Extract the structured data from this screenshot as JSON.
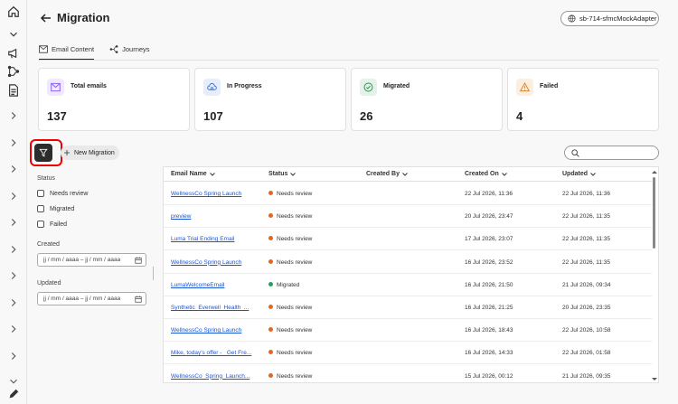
{
  "header": {
    "title": "Migration",
    "sandbox": "sb-714-sfmcMockAdapter"
  },
  "tabs": [
    {
      "label": "Email Content",
      "icon": "mail-icon",
      "active": true
    },
    {
      "label": "Journeys",
      "icon": "journey-icon",
      "active": false
    }
  ],
  "cards": [
    {
      "label": "Total emails",
      "value": "137",
      "icon": "mail-icon",
      "color": "#8b5cf6",
      "bg": "#efe9fd"
    },
    {
      "label": "In Progress",
      "value": "107",
      "icon": "cloud-sync-icon",
      "color": "#3b6fd8",
      "bg": "#e6eefb"
    },
    {
      "label": "Migrated",
      "value": "26",
      "icon": "check-circle-icon",
      "color": "#2f8f4e",
      "bg": "#e3f3e7"
    },
    {
      "label": "Failed",
      "value": "4",
      "icon": "warning-icon",
      "color": "#d9822b",
      "bg": "#fcefe0"
    }
  ],
  "toolbar": {
    "new_migration_label": "New Migration"
  },
  "filters": {
    "status_label": "Status",
    "status_options": [
      "Needs review",
      "Migrated",
      "Failed"
    ],
    "created_label": "Created",
    "created_placeholder": "jj / mm / aaaa – jj / mm / aaaa",
    "updated_label": "Updated",
    "updated_placeholder": "jj / mm / aaaa – jj / mm / aaaa"
  },
  "table": {
    "columns": [
      "Email Name",
      "Status",
      "Created By",
      "Created On",
      "Updated"
    ],
    "rows": [
      {
        "name": "WellnessCo Spring Launch",
        "status": "Needs review",
        "created_by": "",
        "created_on": "22 Jul 2026, 11:36",
        "updated": "22 Jul 2026, 11:36"
      },
      {
        "name": "preview",
        "status": "Needs review",
        "created_by": "",
        "created_on": "20 Jul 2026, 23:47",
        "updated": "22 Jul 2026, 11:35"
      },
      {
        "name": "Luma Trial Ending Email",
        "status": "Needs review",
        "created_by": "",
        "created_on": "17 Jul 2026, 23:07",
        "updated": "22 Jul 2026, 11:35"
      },
      {
        "name": "WellnessCo Spring Launch",
        "status": "Needs review",
        "created_by": "",
        "created_on": "16 Jul 2026, 23:52",
        "updated": "22 Jul 2026, 11:35"
      },
      {
        "name": "LumaWelcomeEmail",
        "status": "Migrated",
        "created_by": "",
        "created_on": "16 Jul 2026, 21:50",
        "updated": "21 Jul 2026, 09:34"
      },
      {
        "name": "Synthetic_Everwell_Health_...",
        "status": "Needs review",
        "created_by": "",
        "created_on": "16 Jul 2026, 21:25",
        "updated": "20 Jul 2026, 23:35"
      },
      {
        "name": "WellnessCo Spring Launch",
        "status": "Needs review",
        "created_by": "",
        "created_on": "16 Jul 2026, 18:43",
        "updated": "22 Jul 2026, 10:58"
      },
      {
        "name": "Mike, today's offer - _Get Fre...",
        "status": "Needs review",
        "created_by": "",
        "created_on": "16 Jul 2026, 14:33",
        "updated": "22 Jul 2026, 01:58"
      },
      {
        "name": "WellnessCo_Spring_Launch...",
        "status": "Needs review",
        "created_by": "",
        "created_on": "15 Jul 2026, 00:12",
        "updated": "21 Jul 2026, 09:35"
      }
    ]
  },
  "status_colors": {
    "Needs review": "#e2671f",
    "Migrated": "#2d9d5a",
    "Failed": "#d7373f"
  }
}
